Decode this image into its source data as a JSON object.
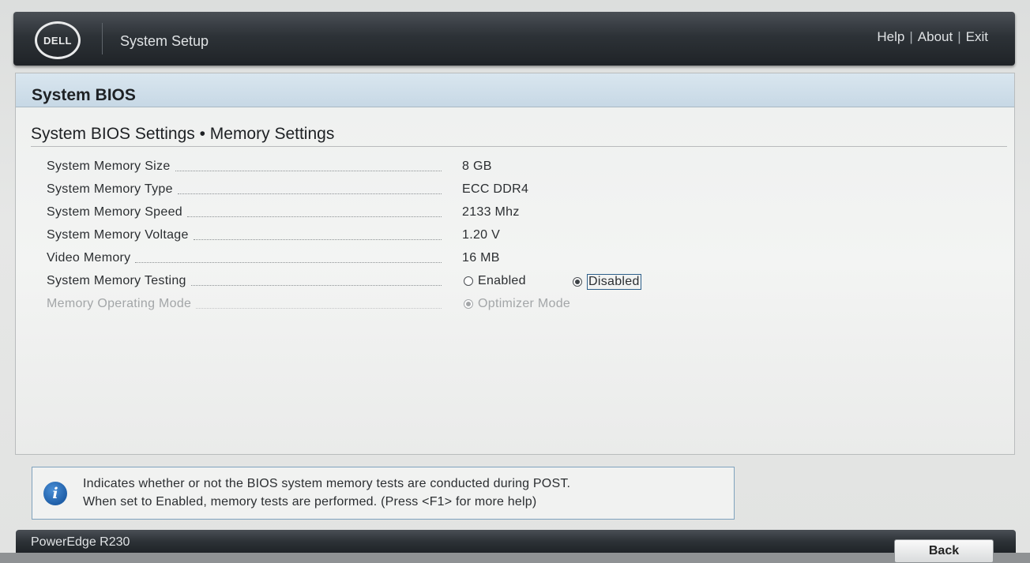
{
  "header": {
    "logo_text": "DELL",
    "app_title": "System Setup",
    "links": [
      "Help",
      "About",
      "Exit"
    ],
    "separator": "|"
  },
  "panel": {
    "title": "System BIOS",
    "section_title": "System BIOS Settings • Memory Settings"
  },
  "settings": [
    {
      "label": "System Memory Size",
      "value": "8 GB"
    },
    {
      "label": "System Memory Type",
      "value": "ECC DDR4"
    },
    {
      "label": "System Memory Speed",
      "value": "2133 Mhz"
    },
    {
      "label": "System Memory Voltage",
      "value": "1.20 V"
    },
    {
      "label": "Video Memory",
      "value": "16 MB"
    },
    {
      "label": "System Memory Testing",
      "options": [
        "Enabled",
        "Disabled"
      ],
      "selected": "Disabled"
    },
    {
      "label": "Memory Operating Mode",
      "options": [
        "Optimizer Mode"
      ],
      "selected": "Optimizer Mode",
      "disabled": true
    }
  ],
  "help": {
    "icon": "info-icon",
    "line1": "Indicates whether or not the BIOS system memory tests are conducted during POST.",
    "line2": "When set to Enabled, memory tests are performed. (Press <F1> for more help)"
  },
  "footer": {
    "model": "PowerEdge R230",
    "back_label": "Back"
  },
  "colors": {
    "header_bg": "#2d3237",
    "panel_header_bg": "#c7d8e5",
    "info_blue": "#1f5fa8",
    "focus_border": "#2d5f8a"
  }
}
